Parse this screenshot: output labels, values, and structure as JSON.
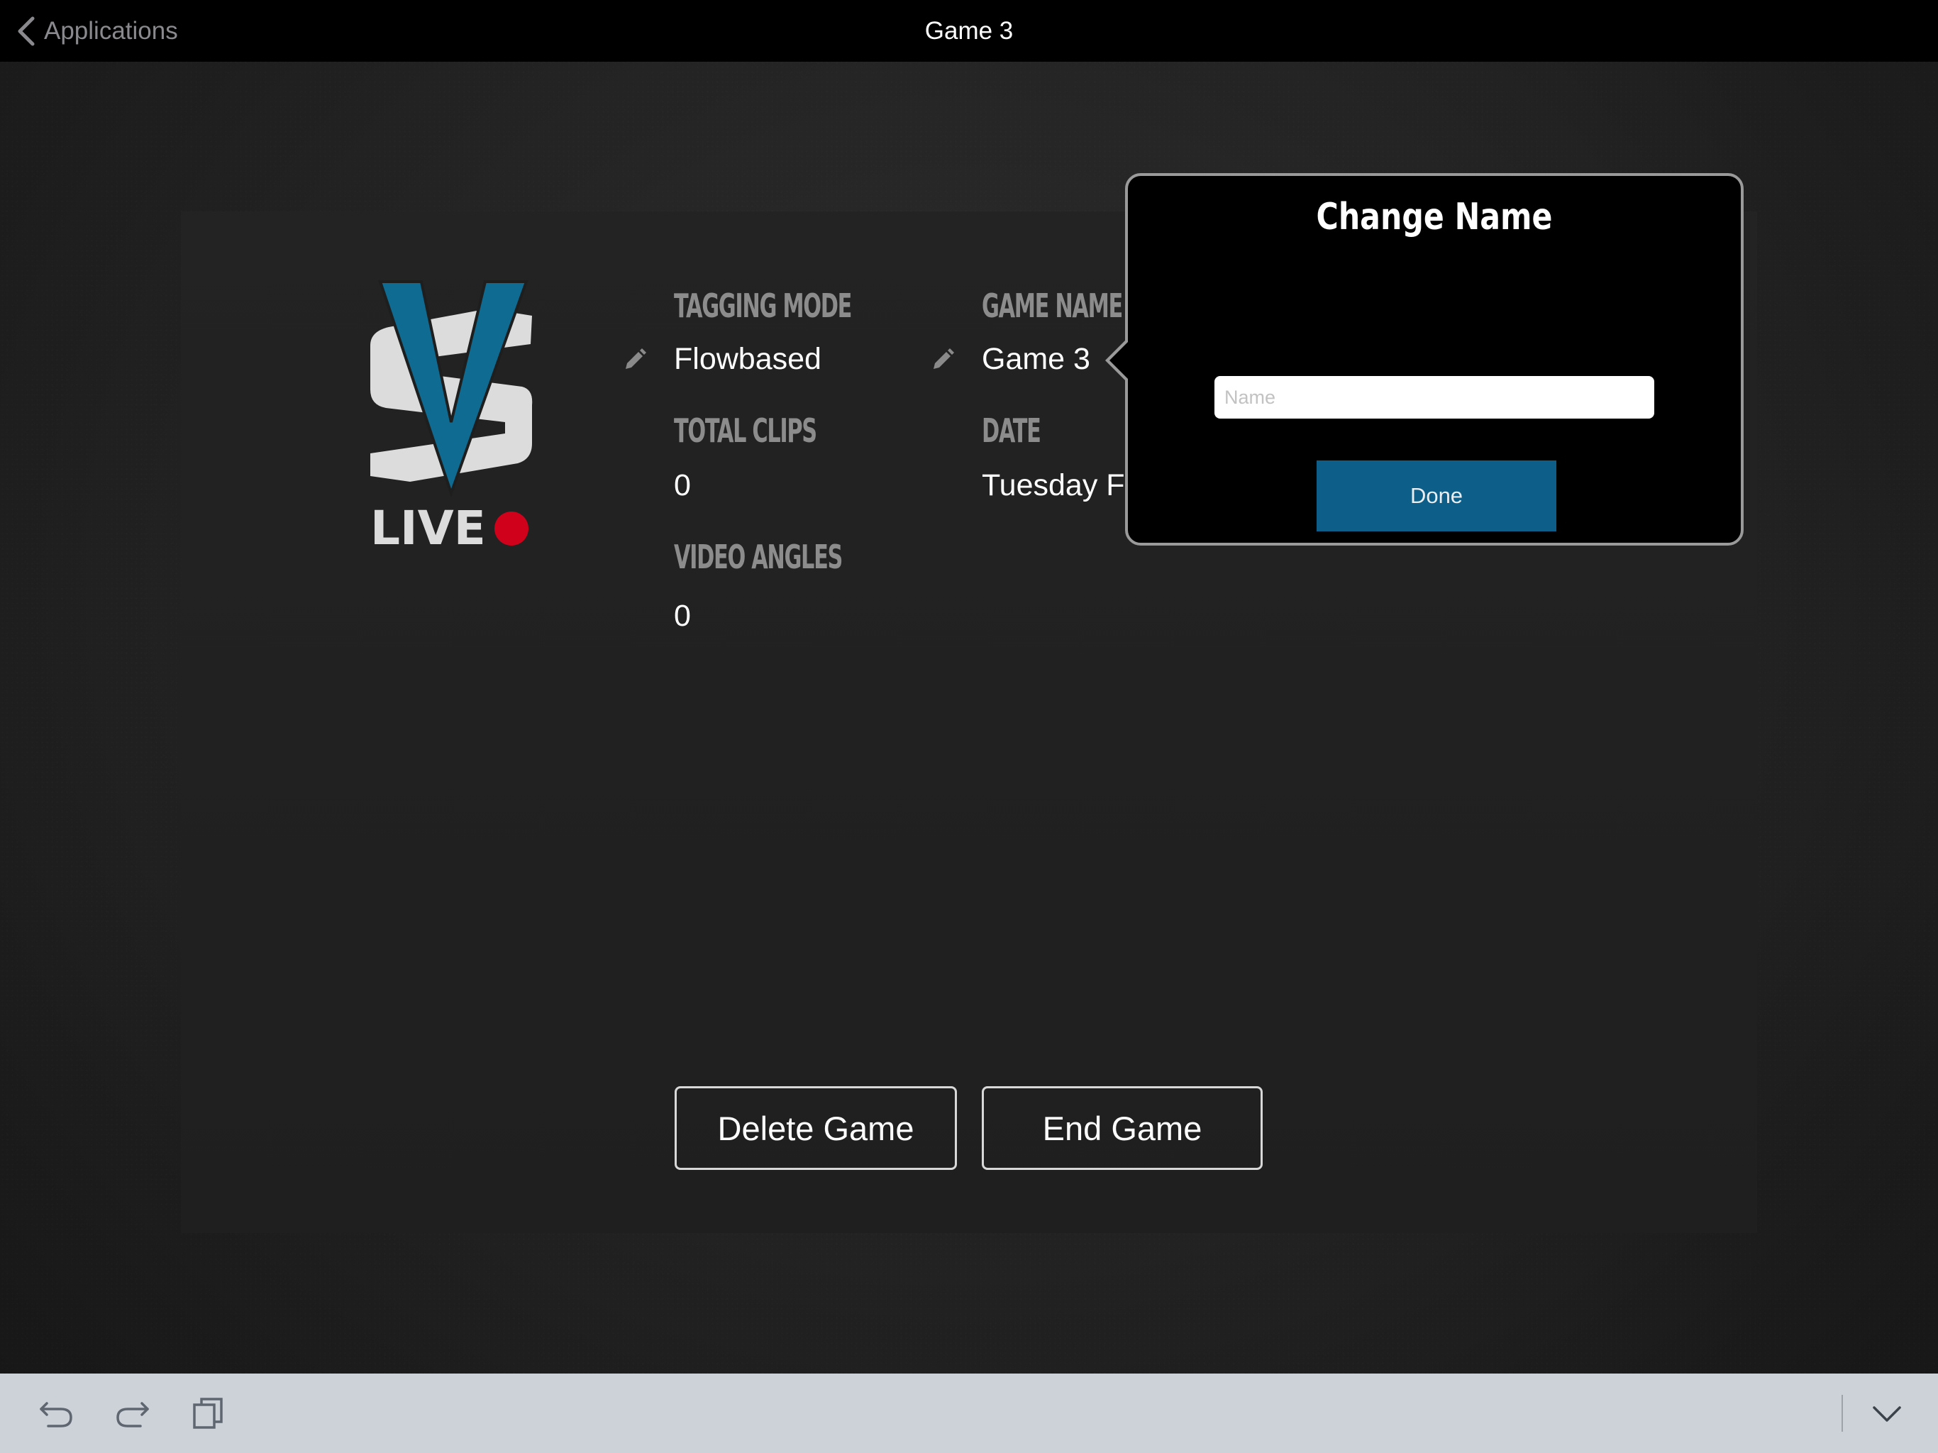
{
  "nav": {
    "back_label": "Applications",
    "title": "Game 3"
  },
  "logo": {
    "text": "LIVE",
    "brand_color": "#0f6b91",
    "record_dot_color": "#d0021b"
  },
  "fields": {
    "tagging_mode": {
      "label": "TAGGING MODE",
      "value": "Flowbased"
    },
    "game_name": {
      "label": "GAME NAME",
      "value": "Game 3"
    },
    "total_clips": {
      "label": "TOTAL CLIPS",
      "value": "0"
    },
    "date": {
      "label": "DATE",
      "value": "Tuesday F"
    },
    "video_angles": {
      "label": "VIDEO ANGLES",
      "value": "0"
    }
  },
  "buttons": {
    "delete_label": "Delete Game",
    "end_label": "End Game"
  },
  "popover": {
    "title": "Change Name",
    "input_value": "",
    "input_placeholder": "Name",
    "done_label": "Done",
    "done_color": "#0d5e88"
  },
  "toolbar": {
    "icons": [
      "undo-icon",
      "redo-icon",
      "copy-icon",
      "chevron-down-icon"
    ]
  }
}
